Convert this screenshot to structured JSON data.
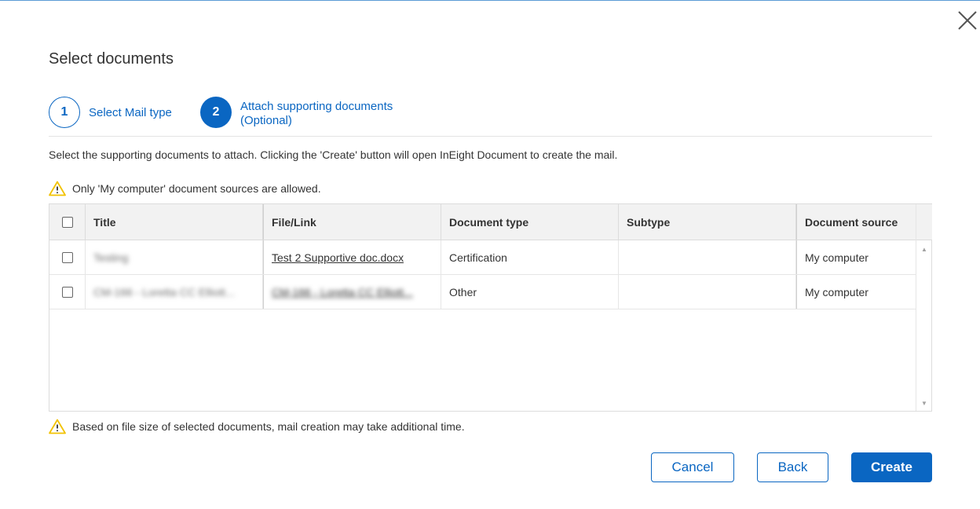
{
  "dialog": {
    "title": "Select documents",
    "close_icon": "close-icon"
  },
  "stepper": {
    "steps": [
      {
        "number": "1",
        "label": "Select Mail type",
        "state": "completed"
      },
      {
        "number": "2",
        "label_line1": "Attach supporting documents",
        "label_line2": "(Optional)",
        "state": "active"
      }
    ]
  },
  "instructions": "Select the supporting documents to attach. Clicking the 'Create' button will open InEight Document to create the mail.",
  "warning_top": "Only 'My computer' document sources are allowed.",
  "warning_bottom": "Based on file size of selected documents, mail creation may take additional time.",
  "warning_icon": "warning-triangle-icon",
  "table": {
    "columns": [
      "Title",
      "File/Link",
      "Document type",
      "Subtype",
      "Document source"
    ],
    "rows": [
      {
        "title": "Testing",
        "file": "Test 2 Supportive doc.docx",
        "document_type": "Certification",
        "subtype": "",
        "source": "My computer"
      },
      {
        "title": "CM-166 - Loretta CC Elliott...",
        "file": "CM-166 - Loretta CC Elliott...",
        "document_type": "Other",
        "subtype": "",
        "source": "My computer"
      }
    ]
  },
  "buttons": {
    "cancel": "Cancel",
    "back": "Back",
    "create": "Create"
  },
  "colors": {
    "primary": "#0a66c2",
    "warning": "#f2c200",
    "header_bg": "#f2f2f2"
  }
}
